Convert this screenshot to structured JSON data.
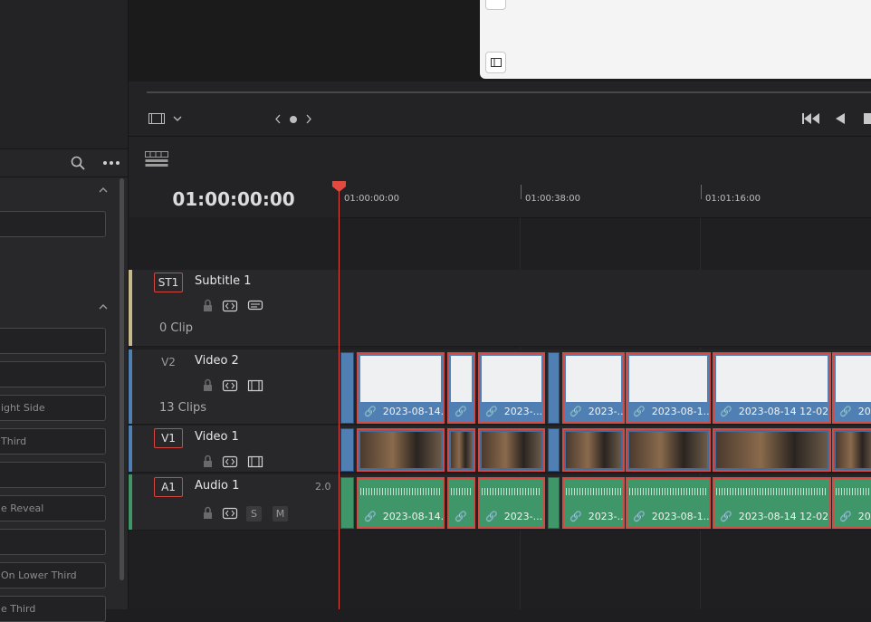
{
  "viewer": {
    "transport_icons": [
      "film-icon",
      "chevron-down-icon",
      "prev-icon",
      "dot-icon",
      "next-icon",
      "go-to-start-icon",
      "play-reverse-icon",
      "stop-icon"
    ]
  },
  "left_panel": {
    "effects": [
      "",
      "",
      "",
      "",
      "ight Side",
      "Third",
      "",
      "e Reveal",
      "",
      "On Lower Third",
      "e Third"
    ]
  },
  "timeline": {
    "timecode": "01:00:00:00",
    "ruler": [
      "01:00:00:00",
      "01:00:38:00",
      "01:01:16:00"
    ],
    "tracks": {
      "st1": {
        "id": "ST1",
        "name": "Subtitle 1",
        "count": "0 Clip",
        "color": "#c8b88a"
      },
      "v2": {
        "id": "V2",
        "name": "Video 2",
        "count": "13 Clips",
        "color": "#4f7fb3"
      },
      "v1": {
        "id": "V1",
        "name": "Video 1",
        "color": "#4f7fb3"
      },
      "a1": {
        "id": "A1",
        "name": "Audio 1",
        "channels": "2.0",
        "solo": "S",
        "mute": "M",
        "color": "#3f9669"
      }
    },
    "v2_clips": [
      "2023-08-14...",
      "20...",
      "2023-...",
      "2023-...",
      "2023-08-1...",
      "2023-08-14 12-02...",
      "2023-..."
    ],
    "a1_clips": [
      "2023-08-14...",
      "20...",
      "2023-...",
      "2023-...",
      "2023-08-1...",
      "2023-08-14 12-02...",
      "2023-..."
    ]
  },
  "colors": {
    "playhead": "#e34a3f",
    "clip_border": "#d24a42",
    "video_clip": "#4f7fb3",
    "audio_clip": "#3f9669"
  }
}
